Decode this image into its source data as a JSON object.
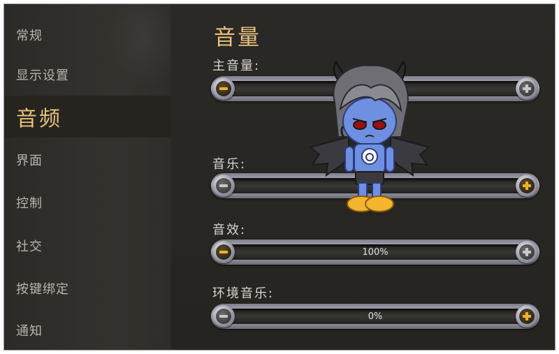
{
  "sidebar": {
    "items": [
      {
        "label": "常规"
      },
      {
        "label": "显示设置"
      },
      {
        "label": "音频",
        "active": true
      },
      {
        "label": "界面"
      },
      {
        "label": "控制"
      },
      {
        "label": "社交"
      },
      {
        "label": "按键绑定"
      },
      {
        "label": "通知"
      }
    ]
  },
  "main": {
    "title": "音量",
    "sliders": [
      {
        "label": "主音量:",
        "value_text": "",
        "minus_icon": "minus-icon",
        "plus_icon": "plus-icon",
        "plus_active": false
      },
      {
        "label": "音乐:",
        "value_text": "",
        "minus_icon": "minus-icon",
        "plus_icon": "plus-icon",
        "plus_active": true
      },
      {
        "label": "音效:",
        "value_text": "100%",
        "minus_icon": "minus-icon",
        "plus_icon": "plus-icon",
        "plus_active": false
      },
      {
        "label": "环境音乐:",
        "value_text": "0%",
        "minus_icon": "minus-icon",
        "plus_icon": "plus-icon",
        "plus_active": true
      }
    ]
  },
  "overlay": {
    "icon": "devil-chibi-character"
  },
  "colors": {
    "accent": "#e8c27d",
    "active_plus": "#f0b02a"
  }
}
